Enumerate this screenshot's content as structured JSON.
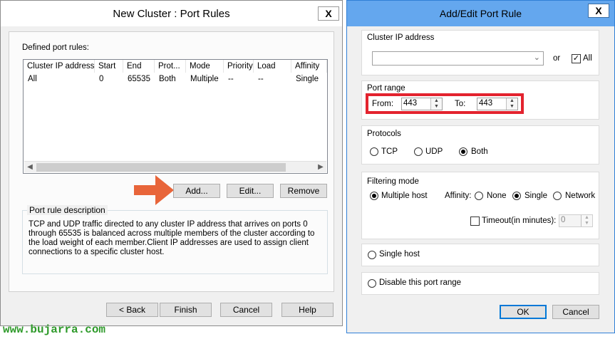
{
  "left_dialog": {
    "title": "New Cluster : Port Rules",
    "close_label": "X",
    "defined_rules_label": "Defined port rules:",
    "columns": [
      "Cluster IP address",
      "Start",
      "End",
      "Prot...",
      "Mode",
      "Priority",
      "Load",
      "Affinity"
    ],
    "rows": [
      [
        "All",
        "0",
        "65535",
        "Both",
        "Multiple",
        "--",
        "--",
        "Single"
      ]
    ],
    "add_label": "Add...",
    "edit_label": "Edit...",
    "remove_label": "Remove",
    "description_title": "Port rule description",
    "description_text": "TCP and UDP traffic directed to any cluster IP address that arrives on ports 0 through 65535 is balanced across multiple members of the cluster according to the load weight of each member.Client IP addresses are used to assign client connections to a specific cluster host.",
    "back_label": "< Back",
    "finish_label": "Finish",
    "cancel_label": "Cancel",
    "help_label": "Help"
  },
  "right_dialog": {
    "title": "Add/Edit Port Rule",
    "close_label": "X",
    "cluster_ip_label": "Cluster IP address",
    "cluster_ip_value": "",
    "or_label": "or",
    "all_label": "All",
    "all_checked": true,
    "port_range_label": "Port range",
    "from_label": "From:",
    "from_value": "443",
    "to_label": "To:",
    "to_value": "443",
    "protocols_label": "Protocols",
    "protocol_options": [
      "TCP",
      "UDP",
      "Both"
    ],
    "protocol_selected": "Both",
    "filtering_label": "Filtering mode",
    "multiple_host_label": "Multiple host",
    "affinity_label": "Affinity:",
    "affinity_options": [
      "None",
      "Single",
      "Network"
    ],
    "affinity_selected": "Single",
    "timeout_label": "Timeout(in minutes):",
    "timeout_value": "0",
    "single_host_label": "Single host",
    "disable_label": "Disable this port range",
    "ok_label": "OK",
    "cancel_label": "Cancel"
  },
  "watermark": "www.bujarra.com",
  "colors": {
    "highlight_box": "#e3232e",
    "arrow": "#e8653a",
    "watermark": "#2e9a2a",
    "title_active": "#64a7ee"
  }
}
